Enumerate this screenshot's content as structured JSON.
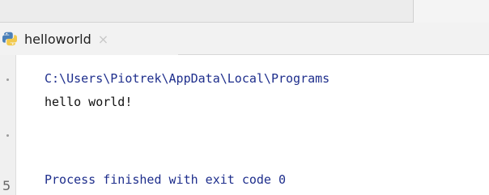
{
  "tab": {
    "label": "helloworld",
    "close_glyph": "×",
    "icon": "python-file-icon"
  },
  "console": {
    "command_line": "C:\\Users\\Piotrek\\AppData\\Local\\Programs",
    "output_line": "hello world!",
    "exit_message": "Process finished with exit code 0"
  },
  "gutter": {
    "number": "5"
  },
  "colors": {
    "console_blue": "#1e2e8c",
    "text_dark": "#111111",
    "tab_bg": "#f2f2f2",
    "python_blue": "#4a7fb8",
    "python_yellow": "#f2c94c"
  }
}
